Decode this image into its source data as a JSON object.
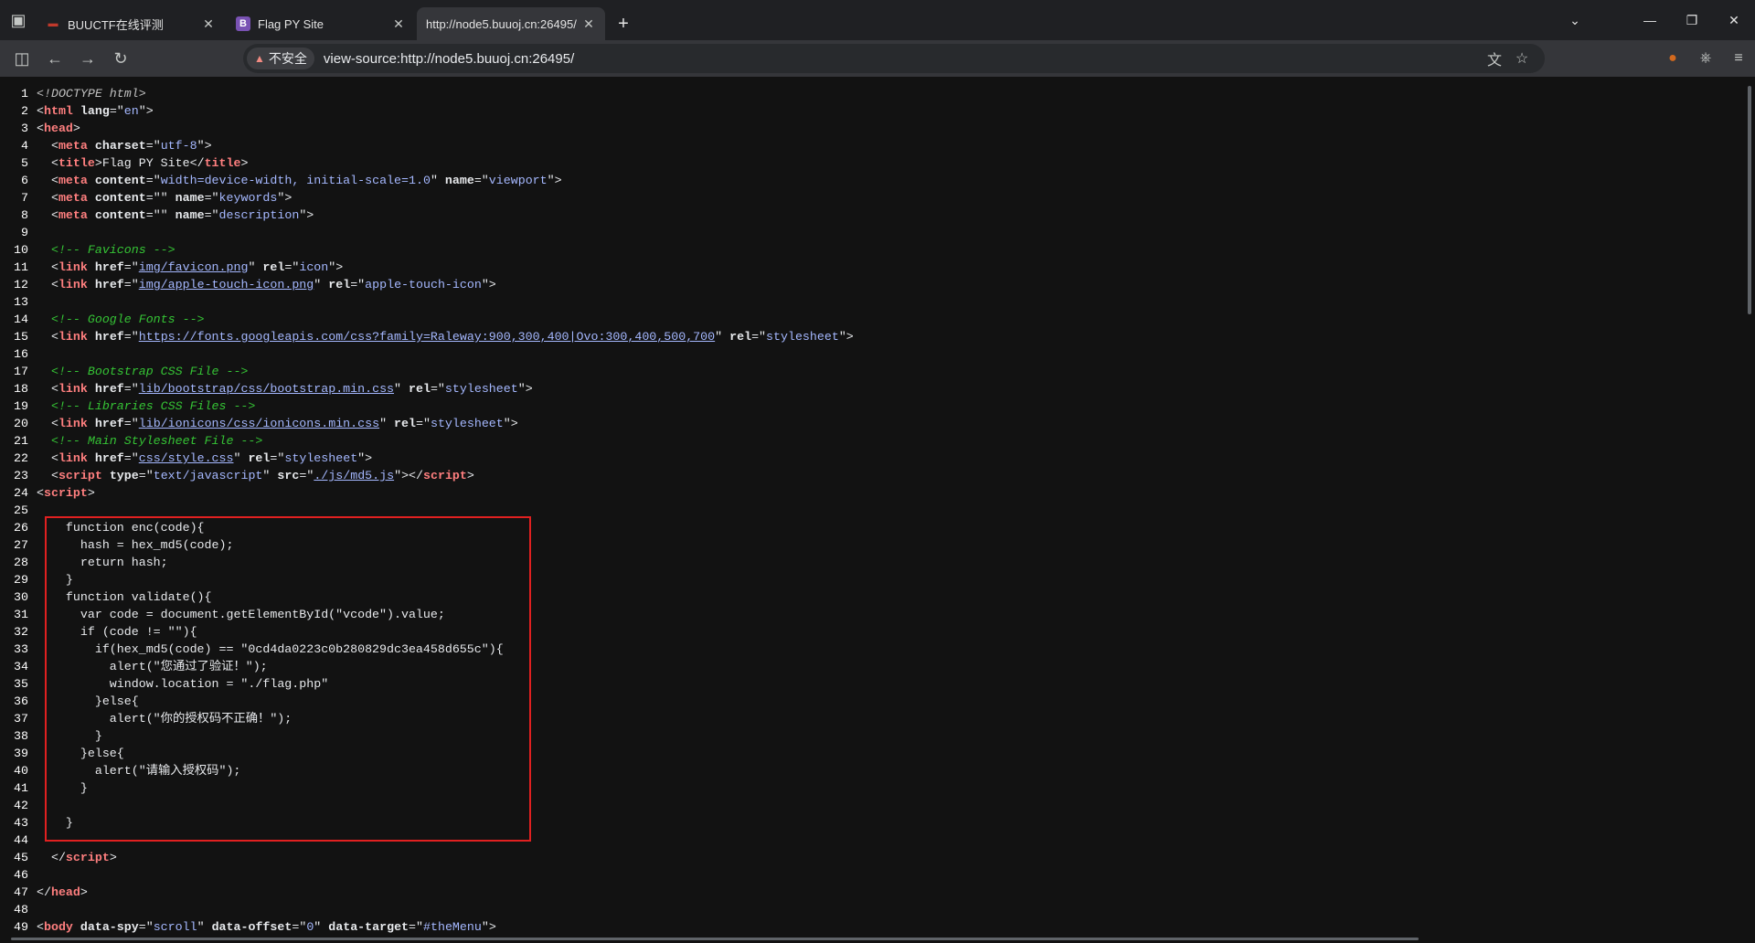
{
  "tabs": [
    {
      "favicon": "buuctf-favicon",
      "label": "BUUCTF在线评测",
      "active": false
    },
    {
      "favicon": "bootstrap-favicon",
      "label": "Flag PY Site",
      "active": false
    },
    {
      "favicon": "",
      "label": "http://node5.buuoj.cn:26495/",
      "active": true
    }
  ],
  "address_bar": {
    "security_label": "不安全",
    "url": "view-source:http://node5.buuoj.cn:26495/"
  },
  "source_lines": [
    {
      "n": "1",
      "html": "<span class=\"d\">&lt;!DOCTYPE html&gt;</span>"
    },
    {
      "n": "2",
      "html": "&lt;<span class=\"t\">html</span> <span class=\"a\">lang</span>=\"<span class=\"v\">en</span>\"&gt;"
    },
    {
      "n": "3",
      "html": "&lt;<span class=\"t\">head</span>&gt;"
    },
    {
      "n": "4",
      "html": "  &lt;<span class=\"t\">meta</span> <span class=\"a\">charset</span>=\"<span class=\"v\">utf-8</span>\"&gt;"
    },
    {
      "n": "5",
      "html": "  &lt;<span class=\"t\">title</span>&gt;Flag PY Site&lt;/<span class=\"t\">title</span>&gt;"
    },
    {
      "n": "6",
      "html": "  &lt;<span class=\"t\">meta</span> <span class=\"a\">content</span>=\"<span class=\"v\">width=device-width, initial-scale=1.0</span>\" <span class=\"a\">name</span>=\"<span class=\"v\">viewport</span>\"&gt;"
    },
    {
      "n": "7",
      "html": "  &lt;<span class=\"t\">meta</span> <span class=\"a\">content</span>=\"\" <span class=\"a\">name</span>=\"<span class=\"v\">keywords</span>\"&gt;"
    },
    {
      "n": "8",
      "html": "  &lt;<span class=\"t\">meta</span> <span class=\"a\">content</span>=\"\" <span class=\"a\">name</span>=\"<span class=\"v\">description</span>\"&gt;"
    },
    {
      "n": "9",
      "html": ""
    },
    {
      "n": "10",
      "html": "  <span class=\"c\">&lt;!-- Favicons --&gt;</span>"
    },
    {
      "n": "11",
      "html": "  &lt;<span class=\"t\">link</span> <span class=\"a\">href</span>=\"<span class=\"l\">img/favicon.png</span>\" <span class=\"a\">rel</span>=\"<span class=\"v\">icon</span>\"&gt;"
    },
    {
      "n": "12",
      "html": "  &lt;<span class=\"t\">link</span> <span class=\"a\">href</span>=\"<span class=\"l\">img/apple-touch-icon.png</span>\" <span class=\"a\">rel</span>=\"<span class=\"v\">apple-touch-icon</span>\"&gt;"
    },
    {
      "n": "13",
      "html": ""
    },
    {
      "n": "14",
      "html": "  <span class=\"c\">&lt;!-- Google Fonts --&gt;</span>"
    },
    {
      "n": "15",
      "html": "  &lt;<span class=\"t\">link</span> <span class=\"a\">href</span>=\"<span class=\"l\">https://fonts.googleapis.com/css?family=Raleway:900,300,400|Ovo:300,400,500,700</span>\" <span class=\"a\">rel</span>=\"<span class=\"v\">stylesheet</span>\"&gt;"
    },
    {
      "n": "16",
      "html": ""
    },
    {
      "n": "17",
      "html": "  <span class=\"c\">&lt;!-- Bootstrap CSS File --&gt;</span>"
    },
    {
      "n": "18",
      "html": "  &lt;<span class=\"t\">link</span> <span class=\"a\">href</span>=\"<span class=\"l\">lib/bootstrap/css/bootstrap.min.css</span>\" <span class=\"a\">rel</span>=\"<span class=\"v\">stylesheet</span>\"&gt;"
    },
    {
      "n": "19",
      "html": "  <span class=\"c\">&lt;!-- Libraries CSS Files --&gt;</span>"
    },
    {
      "n": "20",
      "html": "  &lt;<span class=\"t\">link</span> <span class=\"a\">href</span>=\"<span class=\"l\">lib/ionicons/css/ionicons.min.css</span>\" <span class=\"a\">rel</span>=\"<span class=\"v\">stylesheet</span>\"&gt;"
    },
    {
      "n": "21",
      "html": "  <span class=\"c\">&lt;!-- Main Stylesheet File --&gt;</span>"
    },
    {
      "n": "22",
      "html": "  &lt;<span class=\"t\">link</span> <span class=\"a\">href</span>=\"<span class=\"l\">css/style.css</span>\" <span class=\"a\">rel</span>=\"<span class=\"v\">stylesheet</span>\"&gt;"
    },
    {
      "n": "23",
      "html": "  &lt;<span class=\"t\">script</span> <span class=\"a\">type</span>=\"<span class=\"v\">text/javascript</span>\" <span class=\"a\">src</span>=\"<span class=\"l\">./js/md5.js</span>\"&gt;&lt;/<span class=\"t\">script</span>&gt;"
    },
    {
      "n": "24",
      "html": "&lt;<span class=\"t\">script</span>&gt;"
    },
    {
      "n": "25",
      "html": ""
    },
    {
      "n": "26",
      "html": "    function enc(code){"
    },
    {
      "n": "27",
      "html": "      hash = hex_md5(code);"
    },
    {
      "n": "28",
      "html": "      return hash;"
    },
    {
      "n": "29",
      "html": "    }"
    },
    {
      "n": "30",
      "html": "    function validate(){"
    },
    {
      "n": "31",
      "html": "      var code = document.getElementById(\"vcode\").value;"
    },
    {
      "n": "32",
      "html": "      if (code != \"\"){"
    },
    {
      "n": "33",
      "html": "        if(hex_md5(code) == \"0cd4da0223c0b280829dc3ea458d655c\"){"
    },
    {
      "n": "34",
      "html": "          alert(\"您通过了验证！\");"
    },
    {
      "n": "35",
      "html": "          window.location = \"./flag.php\""
    },
    {
      "n": "36",
      "html": "        }else{"
    },
    {
      "n": "37",
      "html": "          alert(\"你的授权码不正确！\");"
    },
    {
      "n": "38",
      "html": "        }"
    },
    {
      "n": "39",
      "html": "      }else{"
    },
    {
      "n": "40",
      "html": "        alert(\"请输入授权码\");"
    },
    {
      "n": "41",
      "html": "      }"
    },
    {
      "n": "42",
      "html": ""
    },
    {
      "n": "43",
      "html": "    }"
    },
    {
      "n": "44",
      "html": ""
    },
    {
      "n": "45",
      "html": "  &lt;/<span class=\"t\">script</span>&gt;"
    },
    {
      "n": "46",
      "html": ""
    },
    {
      "n": "47",
      "html": "&lt;/<span class=\"t\">head</span>&gt;"
    },
    {
      "n": "48",
      "html": ""
    },
    {
      "n": "49",
      "html": "&lt;<span class=\"t\">body</span> <span class=\"a\">data-spy</span>=\"<span class=\"v\">scroll</span>\" <span class=\"a\">data-offset</span>=\"<span class=\"v\">0</span>\" <span class=\"a\">data-target</span>=\"<span class=\"v\">#theMenu</span>\"&gt;"
    }
  ],
  "colors": {
    "tag": "#ff7f7f",
    "attr_value": "#a5b8ff",
    "comment": "#35c435",
    "highlight_box": "#e02020"
  }
}
